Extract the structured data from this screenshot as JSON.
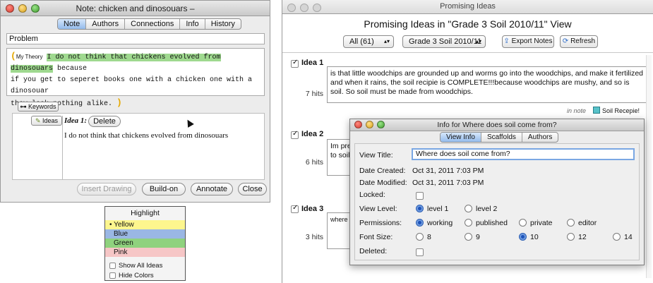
{
  "note_window": {
    "title": "Note: chicken and dinosouars –",
    "tabs": [
      "Note",
      "Authors",
      "Connections",
      "Info",
      "History"
    ],
    "problem_label": "Problem",
    "scaffold_label": "My Theory",
    "text_highlighted": "I do not think that chickens evolved from dinosouars",
    "text_rest_1": " because",
    "text_line2": "if you get to seperet books one with a chicken one with a dinosouar",
    "text_line3": "they look nothing alike.",
    "keywords_button": "Keywords",
    "ideas_button": "Ideas",
    "idea_label": "Idea 1:",
    "delete_button": "Delete",
    "idea_text": "I do not think that chickens evolved from dinosouars",
    "buttons": {
      "insert_drawing": "Insert Drawing",
      "build_on": "Build-on",
      "annotate": "Annotate",
      "close": "Close"
    }
  },
  "highlight_menu": {
    "title": "Highlight",
    "options": [
      {
        "label": "Yellow",
        "color": "#fdf68e",
        "selected": true
      },
      {
        "label": "Blue",
        "color": "#9ab7e4",
        "selected": false
      },
      {
        "label": "Green",
        "color": "#8fd27e",
        "selected": false
      },
      {
        "label": "Pink",
        "color": "#f6c6c6",
        "selected": false
      }
    ],
    "show_all_ideas": "Show All Ideas",
    "hide_colors": "Hide Colors"
  },
  "ideas_window": {
    "title": "Promising Ideas",
    "heading": "Promising Ideas in \"Grade 3 Soil 2010/11\" View",
    "filter_select": "All (61)",
    "view_select": "Grade 3 Soil 2010/11",
    "export_button": "Export Notes",
    "refresh_button": "Refresh",
    "ideas": [
      {
        "label": "Idea 1",
        "hits": "7 hits",
        "text": "is that little woodchips are grounded up and worms go into the woodchips, and make it fertilized and when it rains, the soil recipie is COMPLETE!!!because woodchips are mushy, and so is soil. So soil must be made from woodchips."
      },
      {
        "label": "Idea 2",
        "hits": "6 hits",
        "text": "Im pre to soil"
      },
      {
        "label": "Idea 3",
        "hits": "3 hits",
        "text": "where d"
      }
    ],
    "in_note_label": "in note",
    "note_link": "Soil Recepie!"
  },
  "info_dialog": {
    "title": "Info for Where does soil come from?",
    "tabs": [
      "View Info",
      "Scaffolds",
      "Authors"
    ],
    "view_title_label": "View Title:",
    "view_title_value": "Where does soil come from?",
    "date_created_label": "Date Created:",
    "date_created_value": "Oct 31, 2011 7:03 PM",
    "date_modified_label": "Date Modified:",
    "date_modified_value": "Oct 31, 2011 7:03 PM",
    "locked_label": "Locked:",
    "view_level_label": "View Level:",
    "view_levels": [
      "level 1",
      "level 2"
    ],
    "permissions_label": "Permissions:",
    "permissions": [
      "working",
      "published",
      "private",
      "editor"
    ],
    "font_size_label": "Font Size:",
    "font_sizes": [
      "8",
      "9",
      "10",
      "12",
      "14"
    ],
    "deleted_label": "Deleted:"
  }
}
